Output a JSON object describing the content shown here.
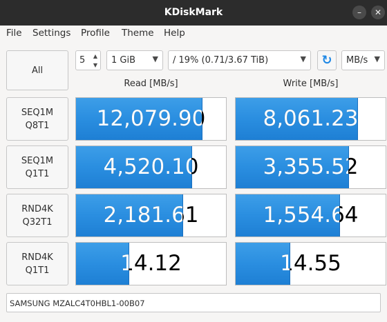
{
  "window": {
    "title": "KDiskMark",
    "minimize": "–",
    "close": "✕"
  },
  "menu": [
    "File",
    "Settings",
    "Profile",
    "Theme",
    "Help"
  ],
  "controls": {
    "all_label": "All",
    "loops": "5",
    "file_size": "1 GiB",
    "target": "/ 19% (0.71/3.67 TiB)",
    "unit": "MB/s"
  },
  "columns": {
    "read": "Read [MB/s]",
    "write": "Write [MB/s]"
  },
  "tests": [
    {
      "line1": "SEQ1M",
      "line2": "Q8T1",
      "read": "12,079.90",
      "write": "8,061.23",
      "read_fill": 0.84,
      "write_fill": 0.81
    },
    {
      "line1": "SEQ1M",
      "line2": "Q1T1",
      "read": "4,520.10",
      "write": "3,355.52",
      "read_fill": 0.77,
      "write_fill": 0.75
    },
    {
      "line1": "RND4K",
      "line2": "Q32T1",
      "read": "2,181.61",
      "write": "1,554.64",
      "read_fill": 0.71,
      "write_fill": 0.69
    },
    {
      "line1": "RND4K",
      "line2": "Q1T1",
      "read": "14.12",
      "write": "14.55",
      "read_fill": 0.35,
      "write_fill": 0.36
    }
  ],
  "comment": "SAMSUNG MZALC4T0HBL1-00B07",
  "colors": {
    "accent": "#2a8ee0",
    "titlebar": "#2c2c2c"
  }
}
